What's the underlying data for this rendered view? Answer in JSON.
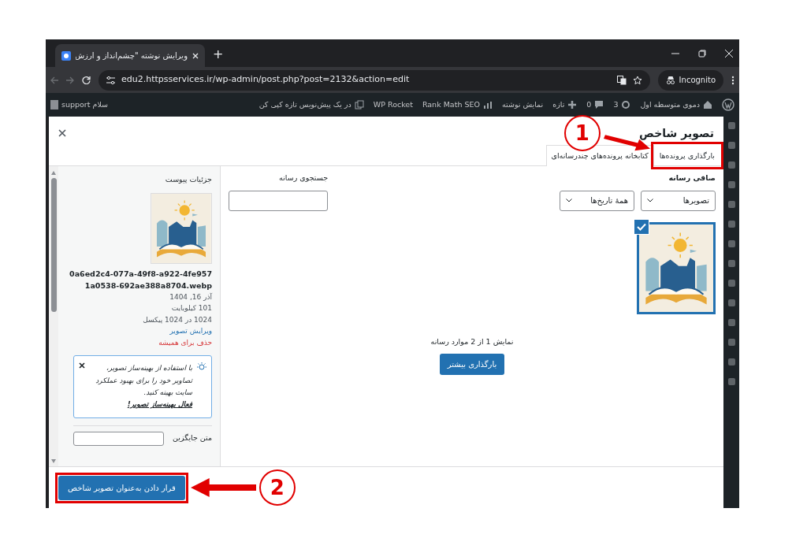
{
  "browser": {
    "tab_title": "ویرایش نوشته \"چشم‌انداز و ارزش",
    "new_tab": "+",
    "url": "edu2.httpsservices.ir/wp-admin/post.php?post=2132&action=edit",
    "incognito": "Incognito"
  },
  "admin_bar": {
    "items": [
      {
        "kind": "site",
        "label": "دموی متوسطه اول"
      },
      {
        "kind": "updates",
        "label": "3"
      },
      {
        "kind": "comments",
        "label": "0"
      },
      {
        "kind": "new",
        "label": "تازه"
      },
      {
        "kind": "plain",
        "label": "نمایش نوشته"
      },
      {
        "kind": "seo",
        "label": "Rank Math SEO"
      },
      {
        "kind": "plain",
        "label": "WP Rocket"
      },
      {
        "kind": "copy",
        "label": "در یک پیش‌نویس تازه کپی کن"
      }
    ],
    "greeting": "سلام support"
  },
  "modal": {
    "title": "تصویر شاخص",
    "tabs": [
      {
        "label": "بارگذاری پرونده‌ها",
        "selected": false
      },
      {
        "label": "کتابخانه پرونده‌های چندرسانه‌ای",
        "selected": true
      }
    ],
    "filter": {
      "label": "صافی رسانه",
      "selects": [
        {
          "value": "تصویرها"
        },
        {
          "value": "همهٔ تاریخ‌ها"
        }
      ]
    },
    "search": {
      "label": "جستجوی رسانه"
    },
    "media_items": [
      {
        "selected": true
      }
    ],
    "status": "نمایش 1 از 2 موارد رسانه",
    "load_more": "بارگذاری بیشتر",
    "details": {
      "heading": "جزئیات پیوست",
      "filename": "0a6ed2c4-077a-49f8-a922-4fe9571a0538-692ae388a8704.webp",
      "date": "آذر 16, 1404",
      "size": "101 کیلوبایت",
      "dimensions": "1024 در 1024 پیکسل",
      "edit_link": "ویرایش تصویر",
      "delete_link": "حذف برای همیشه",
      "notice": {
        "text": "با استفاده از بهینه‌ساز تصویر، تصاویر خود را برای بهبود عملکرد سایت بهینه کنید.",
        "link": "فعال بهینه‌ساز تصویر!"
      },
      "alt_label": "متن جایگزین"
    },
    "set_button": "قرار دادن به‌عنوان تصویر شاخص"
  },
  "annotations": [
    {
      "number": "1"
    },
    {
      "number": "2"
    }
  ]
}
